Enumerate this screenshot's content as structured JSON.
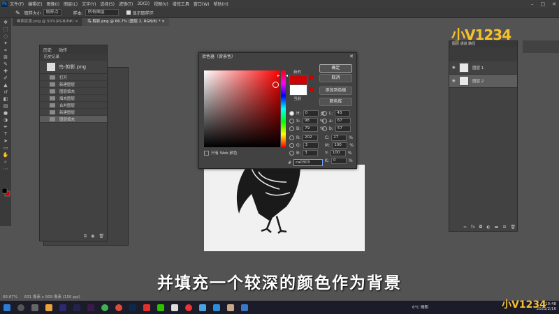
{
  "menubar": {
    "items": [
      "文件(F)",
      "编辑(E)",
      "图像(I)",
      "图层(L)",
      "文字(Y)",
      "选择(S)",
      "滤镜(T)",
      "3D(D)",
      "视图(V)",
      "增效工具",
      "窗口(W)",
      "帮助(H)"
    ]
  },
  "options": {
    "sample_size_label": "取样大小",
    "sample_size_value": "取样点",
    "sample_label": "样本:",
    "sample_value": "所有图层",
    "ring_label": "显示取样环"
  },
  "tabs": [
    {
      "label": "画面实景.png @ 50%(RGB/8#) ×"
    },
    {
      "label": "鸟-剪影.png @ 66.7% (图层 2, RGB/8) * ×"
    }
  ],
  "history": {
    "tabs": [
      "历史",
      "动作"
    ],
    "header": "历史记录",
    "snapshot_label": "鸟-剪影.png",
    "items": [
      "打开",
      "新建图层",
      "图层填充",
      "填充图层",
      "合并图层",
      "新建图层",
      "图层填充"
    ]
  },
  "picker": {
    "title": "拾色器（背景色）",
    "new_label": "新的",
    "current_label": "当前",
    "btn_ok": "确定",
    "btn_cancel": "取消",
    "btn_add": "添加到色板",
    "btn_lib": "颜色库",
    "web_only": "只有 Web 颜色",
    "fields": {
      "H": "0",
      "H_unit": "度",
      "S": "98",
      "S_unit": "%",
      "B": "79",
      "B_unit": "%",
      "R": "202",
      "G": "3",
      "B2": "3",
      "L": "43",
      "a": "67",
      "b": "57",
      "C": "27",
      "M": "100",
      "Y": "100",
      "K": "0"
    },
    "hex": "ca0303",
    "new_color": "#ca0303",
    "current_color": "#ffffff"
  },
  "layers": {
    "tabs": [
      "图层",
      "通道",
      "路径"
    ],
    "items": [
      {
        "name": "图层 1"
      },
      {
        "name": "图层 2"
      }
    ]
  },
  "status": {
    "zoom": "66.67%",
    "doc": "831 像素 x 909 像素 (150 ppi)"
  },
  "subtitle": "并填充一个较深的颜色作为背景",
  "logo": "小V1234",
  "clock": {
    "time": "10:48",
    "date": "2021/2/16"
  },
  "weather": "6°C 晴朗"
}
